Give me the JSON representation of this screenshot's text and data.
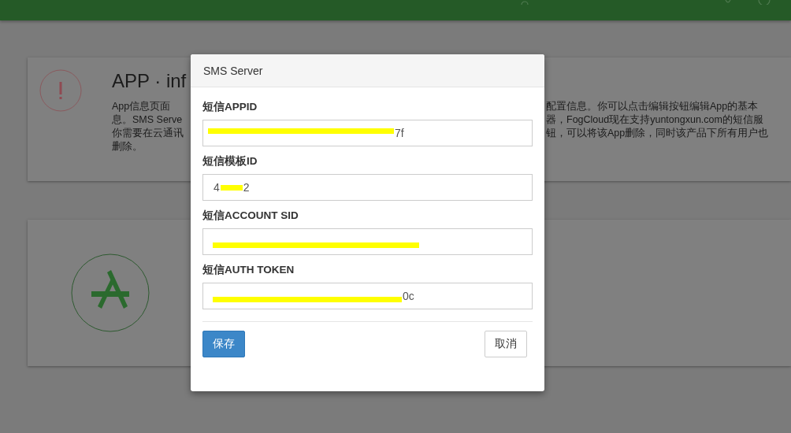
{
  "info_card": {
    "title": "APP · inf",
    "lines_left": [
      "App信息页面",
      "息。SMS Serve",
      "你需要在云通讯",
      "删除。"
    ],
    "lines_right": [
      "配置信息。你可以点击编辑按钮编辑App的基本",
      "器，FogCloud现在支持yuntongxun.com的短信服",
      "钮，可以将该App删除，同时该产品下所有用户也"
    ]
  },
  "modal": {
    "title": "SMS Server",
    "fields": [
      {
        "label": "短信APPID",
        "segments": [
          {
            "kind": "redaction"
          },
          {
            "kind": "text",
            "text": "7f"
          }
        ]
      },
      {
        "label": "短信模板ID",
        "segments": [
          {
            "kind": "text",
            "text": "4"
          },
          {
            "kind": "redaction"
          },
          {
            "kind": "text",
            "text": "2"
          }
        ]
      },
      {
        "label": "短信ACCOUNT SID",
        "segments": [
          {
            "kind": "redaction"
          }
        ]
      },
      {
        "label": "短信AUTH TOKEN",
        "segments": [
          {
            "kind": "redaction"
          },
          {
            "kind": "text",
            "text": "0c"
          }
        ]
      }
    ],
    "buttons": [
      {
        "label": "保存",
        "kind": "primary"
      },
      {
        "label": "取消",
        "kind": "default"
      }
    ]
  }
}
